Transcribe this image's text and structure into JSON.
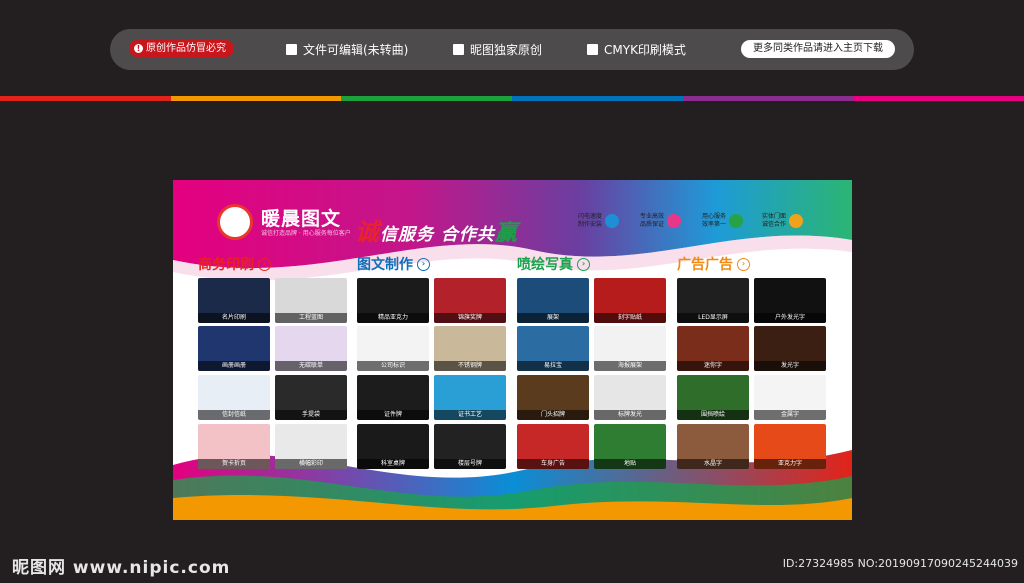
{
  "topbar": {
    "warning": "原创作品仿冒必究",
    "options": [
      "文件可编辑(未转曲)",
      "昵图独家原创",
      "CMYK印刷模式"
    ],
    "more_button": "更多同类作品请进入主页下载"
  },
  "stripe_colors": [
    "#e2231a",
    "#f39800",
    "#1da13d",
    "#0073bc",
    "#8b2c8f",
    "#e4007f"
  ],
  "banner": {
    "brand": "暖晨图文",
    "brand_sub": "诚信打造品牌 · 用心服务每位客户",
    "slogan_a": "诚",
    "slogan_b": "信服务",
    "slogan_c": "合作共",
    "slogan_d": "赢",
    "features": [
      {
        "line1": "闪电速度",
        "line2": "制作安装",
        "icon": "lightning-icon",
        "color": "#1d8fd4"
      },
      {
        "line1": "专业高效",
        "line2": "品质保证",
        "icon": "diamond-icon",
        "color": "#e8378b"
      },
      {
        "line1": "用心服务",
        "line2": "效率第一",
        "icon": "heart-icon",
        "color": "#27a347"
      },
      {
        "line1": "实体门面",
        "line2": "诚信合作",
        "icon": "handshake-icon",
        "color": "#f0a21b"
      }
    ],
    "sections": [
      {
        "title": "商务印刷",
        "color": "#e6231e",
        "tiles": [
          "名片印刷",
          "工程蓝图",
          "画册画册",
          "无碳联单",
          "信封信纸",
          "手提袋",
          "贺卡折页",
          "横幅彩印"
        ]
      },
      {
        "title": "图文制作",
        "color": "#0f6fb8",
        "tiles": [
          "精品亚克力",
          "锦旗奖牌",
          "公司标识",
          "不锈钢牌",
          "证件牌",
          "证书工艺",
          "科室桌牌",
          "楼层号牌"
        ]
      },
      {
        "title": "喷绘写真",
        "color": "#1ba24c",
        "tiles": [
          "展架",
          "刻字贴纸",
          "易拉宝",
          "海报展架",
          "门头招牌",
          "标牌发光",
          "车身广告",
          "地贴"
        ]
      },
      {
        "title": "广告广告",
        "color": "#f08a12",
        "tiles": [
          "LED显示屏",
          "户外发光字",
          "迷你字",
          "发光字",
          "围挡喷绘",
          "金属字",
          "水晶字",
          "亚克力字"
        ]
      }
    ]
  },
  "watermark": {
    "logo": "昵图网 www.nipic.com",
    "id_line": "ID:27324985 NO:20190917090245244039"
  }
}
